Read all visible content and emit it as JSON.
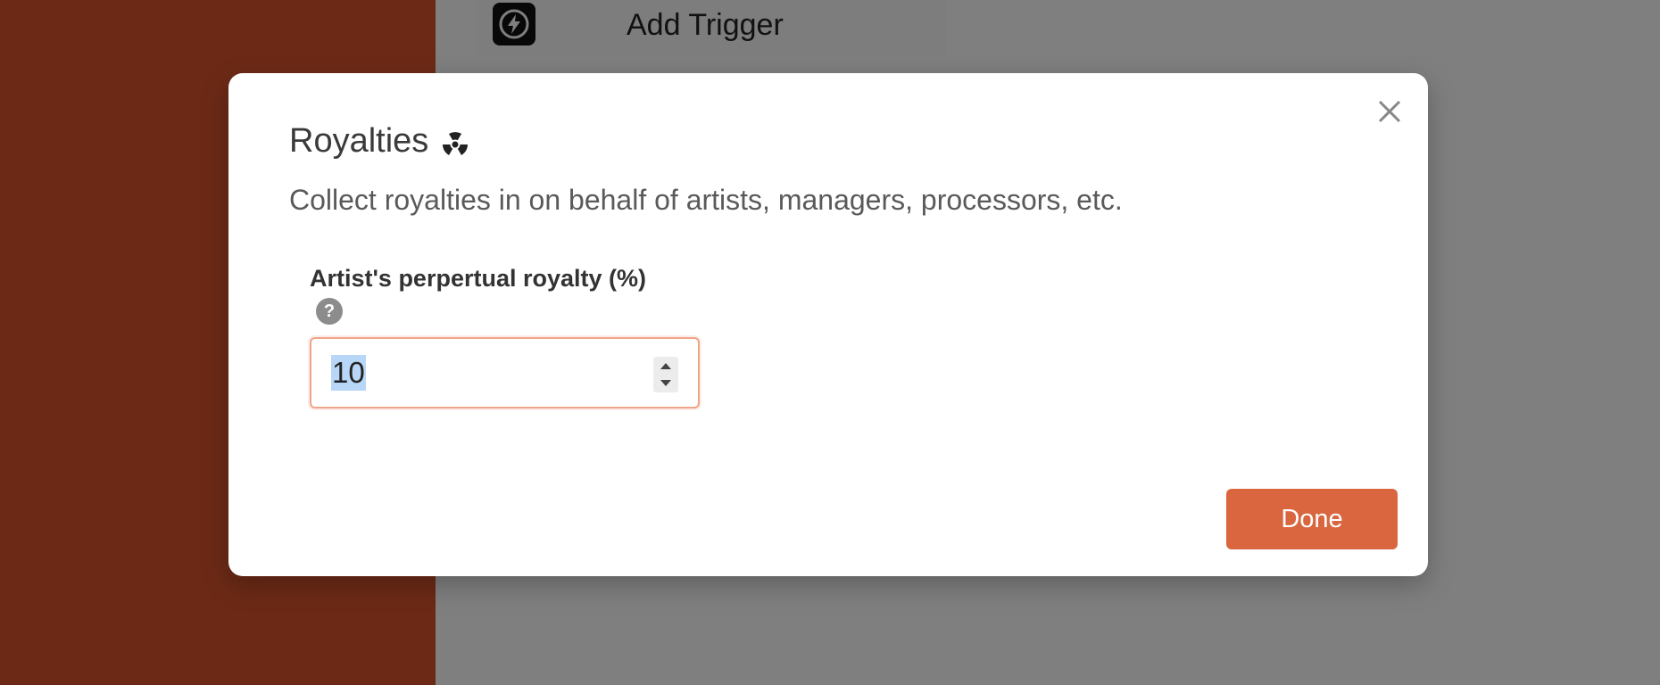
{
  "background": {
    "trigger": {
      "label": "Add Trigger",
      "icon": "lightning-bolt-icon"
    }
  },
  "modal": {
    "title": "Royalties",
    "title_icon": "radiation-icon",
    "description": "Collect royalties in on behalf of artists, managers, processors, etc.",
    "field": {
      "label": "Artist's perpertual royalty (%)",
      "help_icon": "?",
      "value": "10"
    },
    "done_label": "Done"
  },
  "colors": {
    "accent": "#d9663f",
    "sidebar": "#d9552c",
    "input_border": "#f0a48a",
    "selection": "#b8d6f7"
  }
}
